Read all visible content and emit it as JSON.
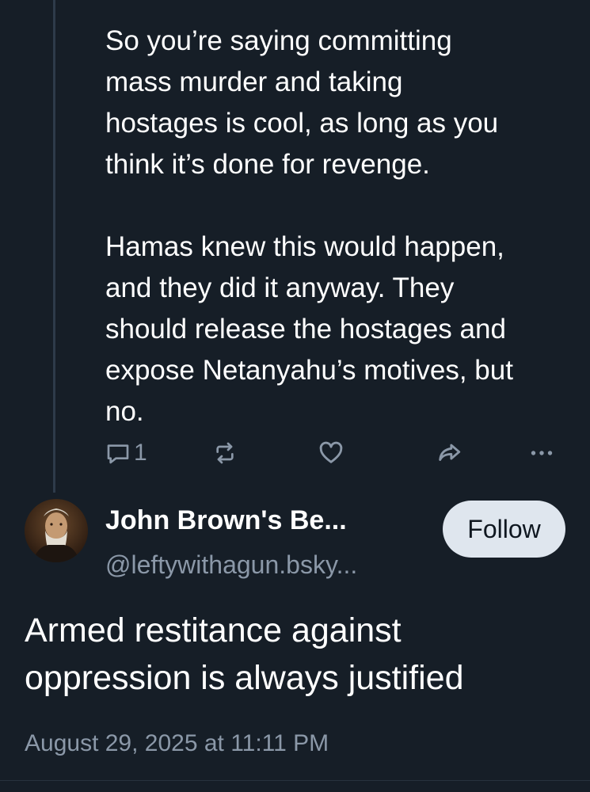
{
  "reply": {
    "text": "So you’re saying committing\nmass murder and taking\nhostages is cool, as long as you\nthink it’s done for revenge.\n\nHamas knew this would happen,\nand they did it anyway. They\nshould release the hostages and\nexpose Netanyahu’s motives, but\nno.",
    "reply_count": "1",
    "actions": {
      "reply_icon": "comment-icon",
      "repost_icon": "repost-icon",
      "like_icon": "heart-icon",
      "share_icon": "share-icon",
      "more_icon": "more-dots-icon"
    }
  },
  "post": {
    "author": {
      "display_name": "John Brown's Be...",
      "handle": "@leftywithagun.bsky..."
    },
    "follow_label": "Follow",
    "text": "Armed restitance against\noppression is always justified",
    "timestamp": "August 29, 2025 at 11:11 PM"
  },
  "colors": {
    "background": "#161e27",
    "text": "#ffffff",
    "muted": "#8b98a8",
    "thread_line": "#2e3b4a",
    "button_bg": "#dfe6ee"
  }
}
